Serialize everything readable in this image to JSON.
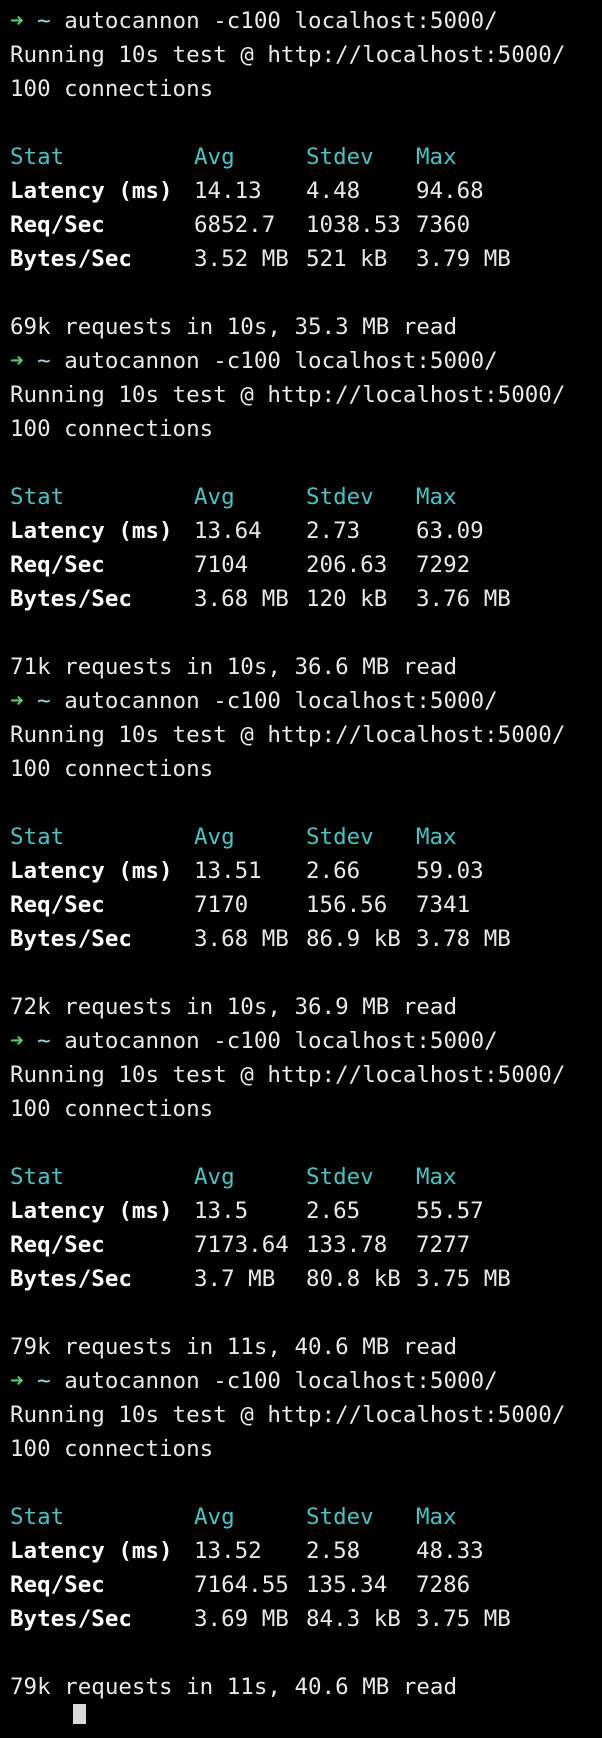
{
  "prompt": {
    "arrow": "➜",
    "dir": "~"
  },
  "command": "autocannon -c100 localhost:5000/",
  "running": "Running 10s test @ http://localhost:5000/",
  "connections": "100 connections",
  "header": [
    "Stat",
    "Avg",
    "Stdev",
    "Max"
  ],
  "labels": [
    "Latency (ms)",
    "Req/Sec",
    "Bytes/Sec"
  ],
  "colors": {
    "prompt_arrow": "#4fd35a",
    "header": "#3fc7c7",
    "text": "#e8e8e8",
    "background": "#000000"
  },
  "runs": [
    {
      "rows": [
        [
          "14.13",
          "4.48",
          "94.68"
        ],
        [
          "6852.7",
          "1038.53",
          "7360"
        ],
        [
          "3.52 MB",
          "521 kB",
          "3.79 MB"
        ]
      ],
      "summary": "69k requests in 10s, 35.3 MB read"
    },
    {
      "rows": [
        [
          "13.64",
          "2.73",
          "63.09"
        ],
        [
          "7104",
          "206.63",
          "7292"
        ],
        [
          "3.68 MB",
          "120 kB",
          "3.76 MB"
        ]
      ],
      "summary": "71k requests in 10s, 36.6 MB read"
    },
    {
      "rows": [
        [
          "13.51",
          "2.66",
          "59.03"
        ],
        [
          "7170",
          "156.56",
          "7341"
        ],
        [
          "3.68 MB",
          "86.9 kB",
          "3.78 MB"
        ]
      ],
      "summary": "72k requests in 10s, 36.9 MB read"
    },
    {
      "rows": [
        [
          "13.5",
          "2.65",
          "55.57"
        ],
        [
          "7173.64",
          "133.78",
          "7277"
        ],
        [
          "3.7 MB",
          "80.8 kB",
          "3.75 MB"
        ]
      ],
      "summary": "79k requests in 11s, 40.6 MB read"
    },
    {
      "rows": [
        [
          "13.52",
          "2.58",
          "48.33"
        ],
        [
          "7164.55",
          "135.34",
          "7286"
        ],
        [
          "3.69 MB",
          "84.3 kB",
          "3.75 MB"
        ]
      ],
      "summary": "79k requests in 11s, 40.6 MB read"
    }
  ]
}
